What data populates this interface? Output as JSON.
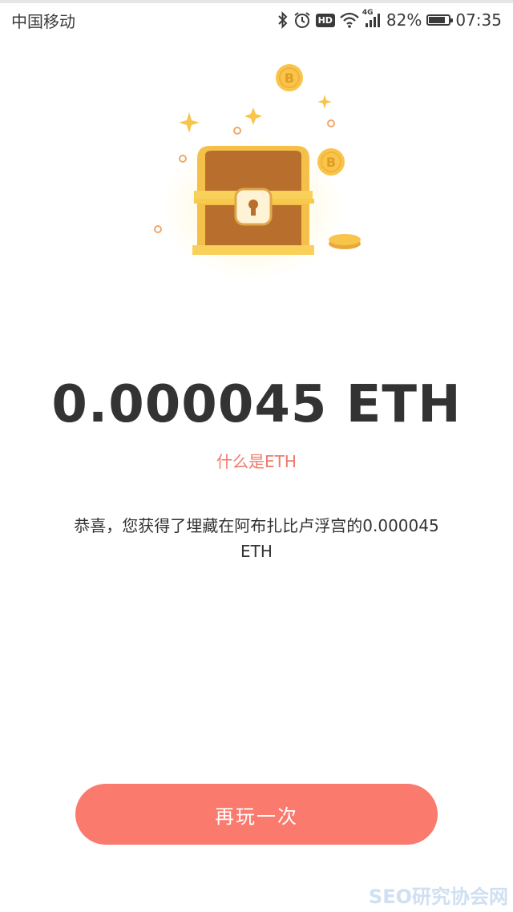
{
  "status_bar": {
    "carrier": "中国移动",
    "hd_badge": "HD",
    "network": "4G",
    "battery_percent": "82%",
    "battery_level": 0.82,
    "time": "07:35"
  },
  "illustration": {
    "coin_symbol": "B",
    "icon": "treasure-chest-icon"
  },
  "result": {
    "amount": "0.000045 ETH",
    "what_link": "什么是ETH",
    "message": "恭喜，您获得了埋藏在阿布扎比卢浮宫的0.000045 ETH"
  },
  "actions": {
    "replay_label": "再玩一次"
  },
  "watermark": "SEO研究协会网",
  "colors": {
    "accent": "#fb7a6e",
    "link": "#f07a6a",
    "gold": "#f8c54a",
    "chest_wood": "#b86f2e"
  }
}
